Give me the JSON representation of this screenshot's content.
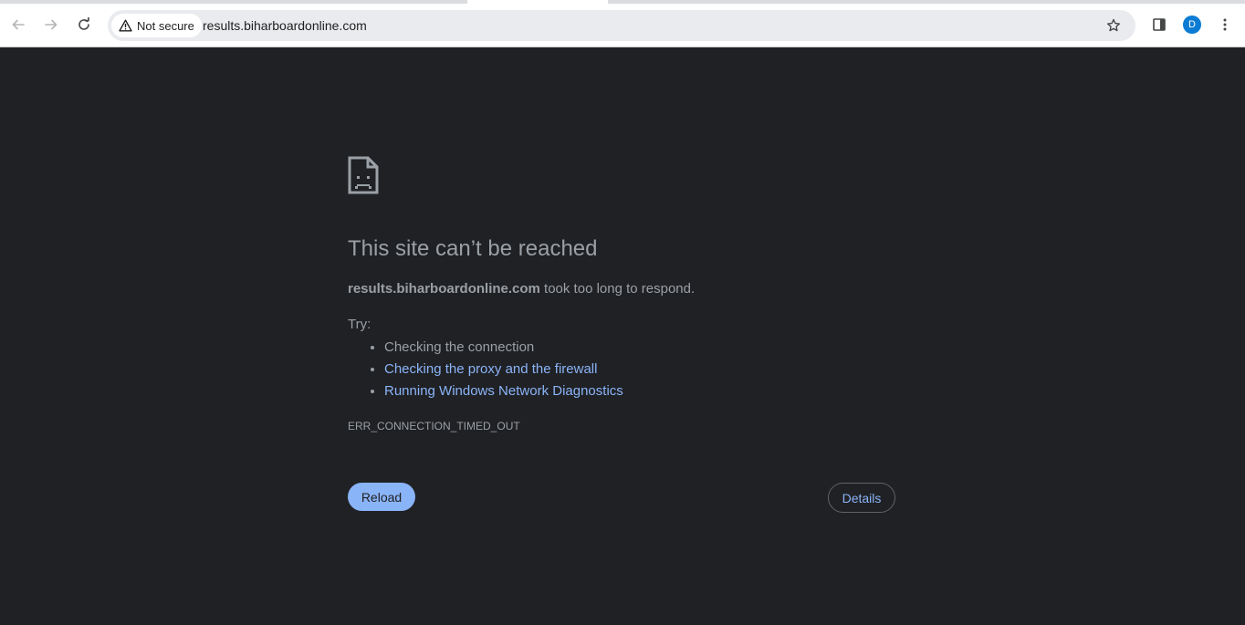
{
  "toolbar": {
    "security_label": "Not secure",
    "url": "results.biharboardonline.com",
    "avatar_initial": "D"
  },
  "icons": {
    "back": "arrow-left-icon",
    "forward": "arrow-right-icon",
    "reload": "reload-icon",
    "warning": "warning-triangle-icon",
    "bookmark": "star-icon",
    "side_panel": "side-panel-icon",
    "menu": "kebab-menu-icon",
    "error_page": "sad-page-icon"
  },
  "error_page": {
    "heading": "This site can’t be reached",
    "host": "results.biharboardonline.com",
    "summary_suffix": " took too long to respond.",
    "try_label": "Try:",
    "suggestions": [
      "Checking the connection",
      "Checking the proxy and the firewall",
      "Running Windows Network Diagnostics"
    ],
    "error_code": "ERR_CONNECTION_TIMED_OUT",
    "reload_label": "Reload",
    "details_label": "Details"
  },
  "colors": {
    "page_background": "#202124",
    "text": "#9aa0a6",
    "link": "#8ab4f8",
    "avatar": "#0b7bd3"
  }
}
